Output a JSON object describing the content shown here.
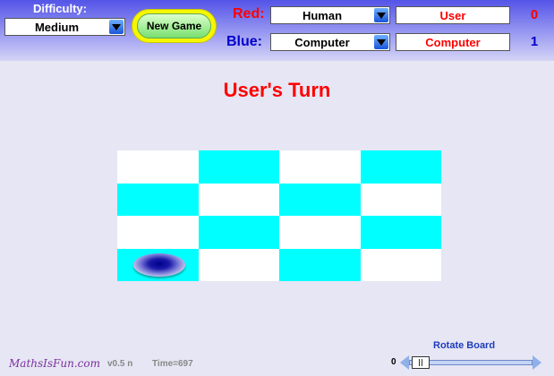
{
  "difficulty": {
    "label": "Difficulty:",
    "value": "Medium"
  },
  "new_game_label": "New Game",
  "players": [
    {
      "label": "Red:",
      "type": "Human",
      "name": "User",
      "score": "0",
      "color": "#ff0000"
    },
    {
      "label": "Blue:",
      "type": "Computer",
      "name": "Computer",
      "score": "1",
      "color": "#0000cc"
    }
  ],
  "status": "User's Turn",
  "board": {
    "rows": 4,
    "cols": 4,
    "colors": {
      "light": "#ffffff",
      "dark": "#00ffff"
    },
    "piece": {
      "row": 4,
      "col": 1,
      "color": "blue"
    }
  },
  "footer": {
    "logo": "MathsIsFun.com",
    "version": "v0.5 n",
    "time": "Time=697",
    "rotate_label": "Rotate Board",
    "rotate_value": "0"
  }
}
